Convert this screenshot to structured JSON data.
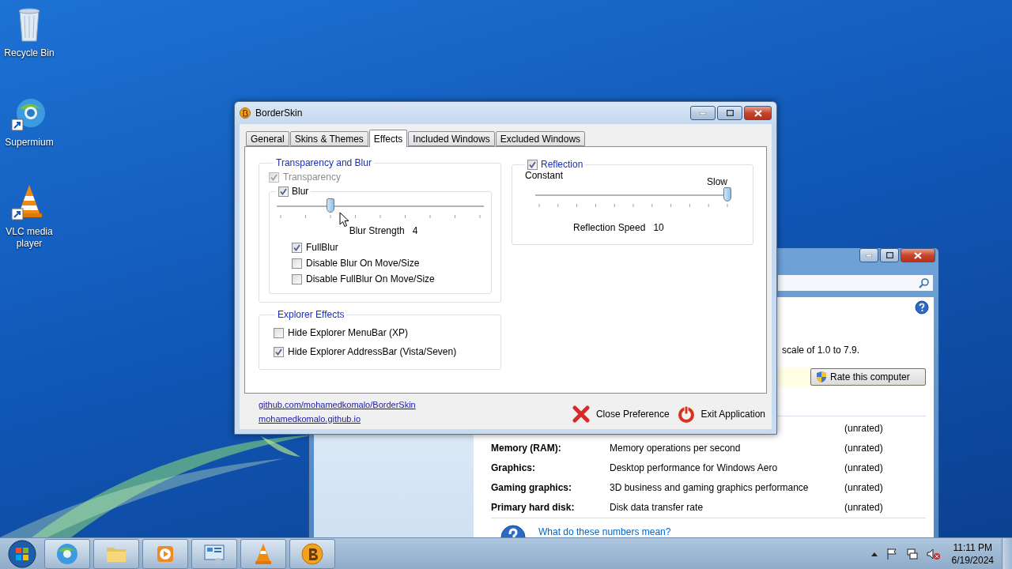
{
  "desktop_icons": [
    {
      "kind": "recycle-bin",
      "label": "Recycle Bin"
    },
    {
      "kind": "browser",
      "label": "Supermium"
    },
    {
      "kind": "cone",
      "label": "VLC media player"
    }
  ],
  "back_window": {
    "scale_text": "scale of 1.0 to 7.9.",
    "rate_button": "Rate this computer",
    "rows": [
      {
        "score": "(unrated)"
      },
      {
        "component": "Memory (RAM):",
        "description": "Memory operations per second",
        "score": "(unrated)"
      },
      {
        "component": "Graphics:",
        "description": "Desktop performance for Windows Aero",
        "score": "(unrated)"
      },
      {
        "component": "Gaming graphics:",
        "description": "3D business and gaming graphics performance",
        "score": "(unrated)"
      },
      {
        "component": "Primary hard disk:",
        "description": "Disk data transfer rate",
        "score": "(unrated)"
      }
    ],
    "help_link": "What do these numbers mean?"
  },
  "window": {
    "title": "BorderSkin",
    "tabs": [
      {
        "label": "General",
        "selected": false
      },
      {
        "label": "Skins & Themes",
        "selected": false
      },
      {
        "label": "Effects",
        "selected": true
      },
      {
        "label": "Included Windows",
        "selected": false
      },
      {
        "label": "Excluded Windows",
        "selected": false
      }
    ],
    "transparency_group": {
      "title": "Transparency and Blur",
      "transparency": {
        "label": "Transparency",
        "checked": true,
        "disabled": true
      },
      "blur": {
        "label": "Blur",
        "checked": true
      },
      "blur_strength": {
        "level": 0.25,
        "label": "Blur Strength",
        "value": "4"
      },
      "options": [
        {
          "label": "FullBlur",
          "checked": true
        },
        {
          "label": "Disable Blur On Move/Size",
          "checked": false
        },
        {
          "label": "Disable FullBlur On Move/Size",
          "checked": false
        }
      ]
    },
    "explorer_group": {
      "title": "Explorer Effects",
      "options": [
        {
          "label": "Hide Explorer MenuBar (XP)",
          "checked": false
        },
        {
          "label": "Hide Explorer AddressBar (Vista/Seven)",
          "checked": true
        }
      ]
    },
    "reflection_group": {
      "label": "Reflection",
      "checked": true,
      "min_label": "Constant",
      "max_label": "Slow",
      "speed": {
        "level": 1,
        "label": "Reflection Speed",
        "value": "10"
      }
    },
    "links": [
      "github.com/mohamedkomalo/BorderSkin",
      "mohamedkomalo.github.io"
    ],
    "buttons": [
      {
        "kind": "close",
        "label": "Close Preference"
      },
      {
        "kind": "exit",
        "label": "Exit Application"
      }
    ]
  },
  "taskbar": {
    "buttons": [
      {
        "kind": "browser"
      },
      {
        "kind": "folder"
      },
      {
        "kind": "player"
      },
      {
        "kind": "control-panel"
      },
      {
        "kind": "cone"
      },
      {
        "kind": "borderskin"
      }
    ],
    "clock": {
      "time": "11:11 PM",
      "date": "6/19/2024"
    }
  }
}
